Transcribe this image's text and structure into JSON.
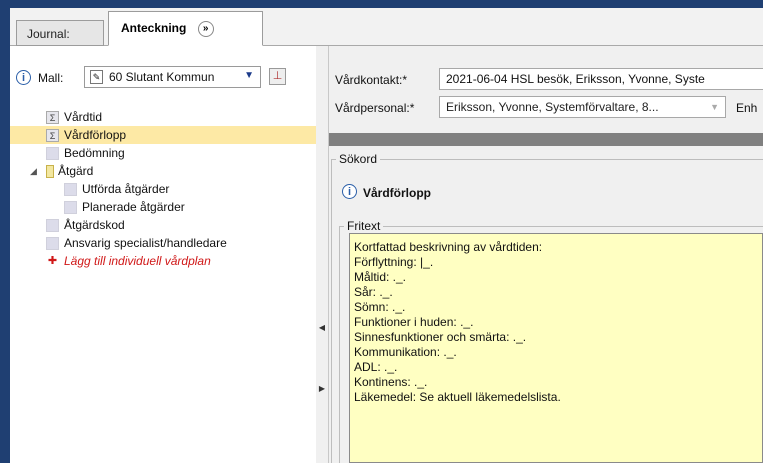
{
  "tabs": [
    {
      "label": "Journal:"
    },
    {
      "label": "Anteckning"
    }
  ],
  "mall": {
    "label": "Mall:",
    "value": "60 Slutant Kommun"
  },
  "tree": [
    {
      "label": "Vårdtid",
      "icon": "sigma-icon"
    },
    {
      "label": "Vårdförlopp",
      "icon": "sigma-icon",
      "selected": true
    },
    {
      "label": "Bedömning",
      "icon": "doc-icon"
    },
    {
      "label": "Åtgärd",
      "icon": "folder-icon",
      "expanded": true
    },
    {
      "label": "Utförda åtgärder",
      "icon": "doc-icon"
    },
    {
      "label": "Planerade åtgärder",
      "icon": "doc-icon"
    },
    {
      "label": "Åtgärdskod",
      "icon": "doc-icon"
    },
    {
      "label": "Ansvarig specialist/handledare",
      "icon": "doc-icon"
    },
    {
      "label": "Lägg till individuell vårdplan",
      "icon": "add-plan-icon",
      "color": "#d01818"
    }
  ],
  "form": {
    "vardkontakt_label": "Vårdkontakt:*",
    "vardkontakt_value": "2021-06-04 HSL besök, Eriksson, Yvonne, Syste",
    "vardpersonal_label": "Vårdpersonal:*",
    "vardpersonal_value": "Eriksson, Yvonne, Systemförvaltare, 8...",
    "enhet_label": "Enh",
    "sokord_label": "Sökord",
    "section_title": "Vårdförlopp",
    "fritext_label": "Fritext"
  },
  "fritext_lines": [
    "Kortfattad beskrivning av vårdtiden:",
    "Förflyttning: |_.",
    "Måltid: ._.",
    "Sår: ._.",
    "Sömn: ._.",
    "Funktioner i huden: ._.",
    "Sinnesfunktioner och smärta: ._.",
    "Kommunikation: ._.",
    "ADL: ._.",
    "Kontinens: ._.",
    "Läkemedel: Se aktuell läkemedelslista."
  ],
  "colors": {
    "title_bar": "#1f3f72",
    "selected_row": "#fde9a5",
    "fritext_bg": "#ffffc2",
    "link_red": "#d01818"
  }
}
